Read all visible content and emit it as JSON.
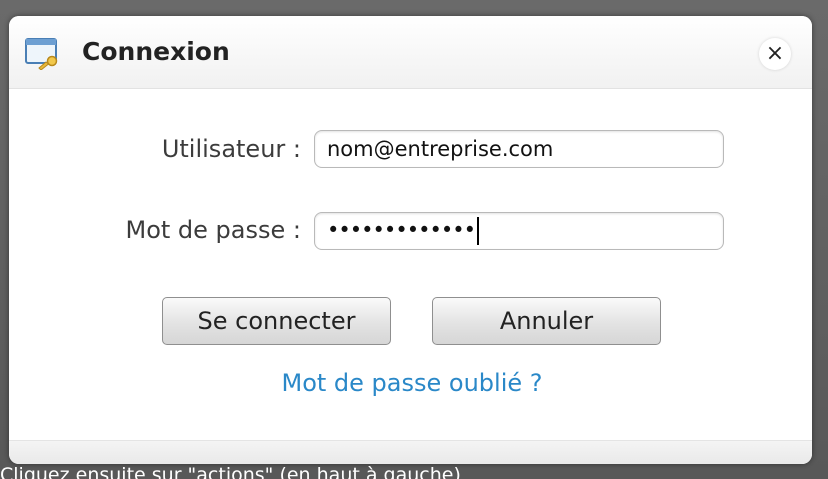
{
  "dialog": {
    "title": "Connexion",
    "close_glyph": "×",
    "icon": "window-key-icon"
  },
  "form": {
    "user_label": "Utilisateur :",
    "user_value": "nom@entreprise.com",
    "password_label": "Mot de passe :",
    "password_value": "•••••••••••••"
  },
  "buttons": {
    "connect_label": "Se connecter",
    "cancel_label": "Annuler"
  },
  "forgot_link": "Mot de passe oublié ?",
  "bottom_caption": "Cliquez ensuite sur \"actions\" (en haut à gauche)",
  "colors": {
    "link": "#2a88c8",
    "background": "#5f5f5f"
  }
}
